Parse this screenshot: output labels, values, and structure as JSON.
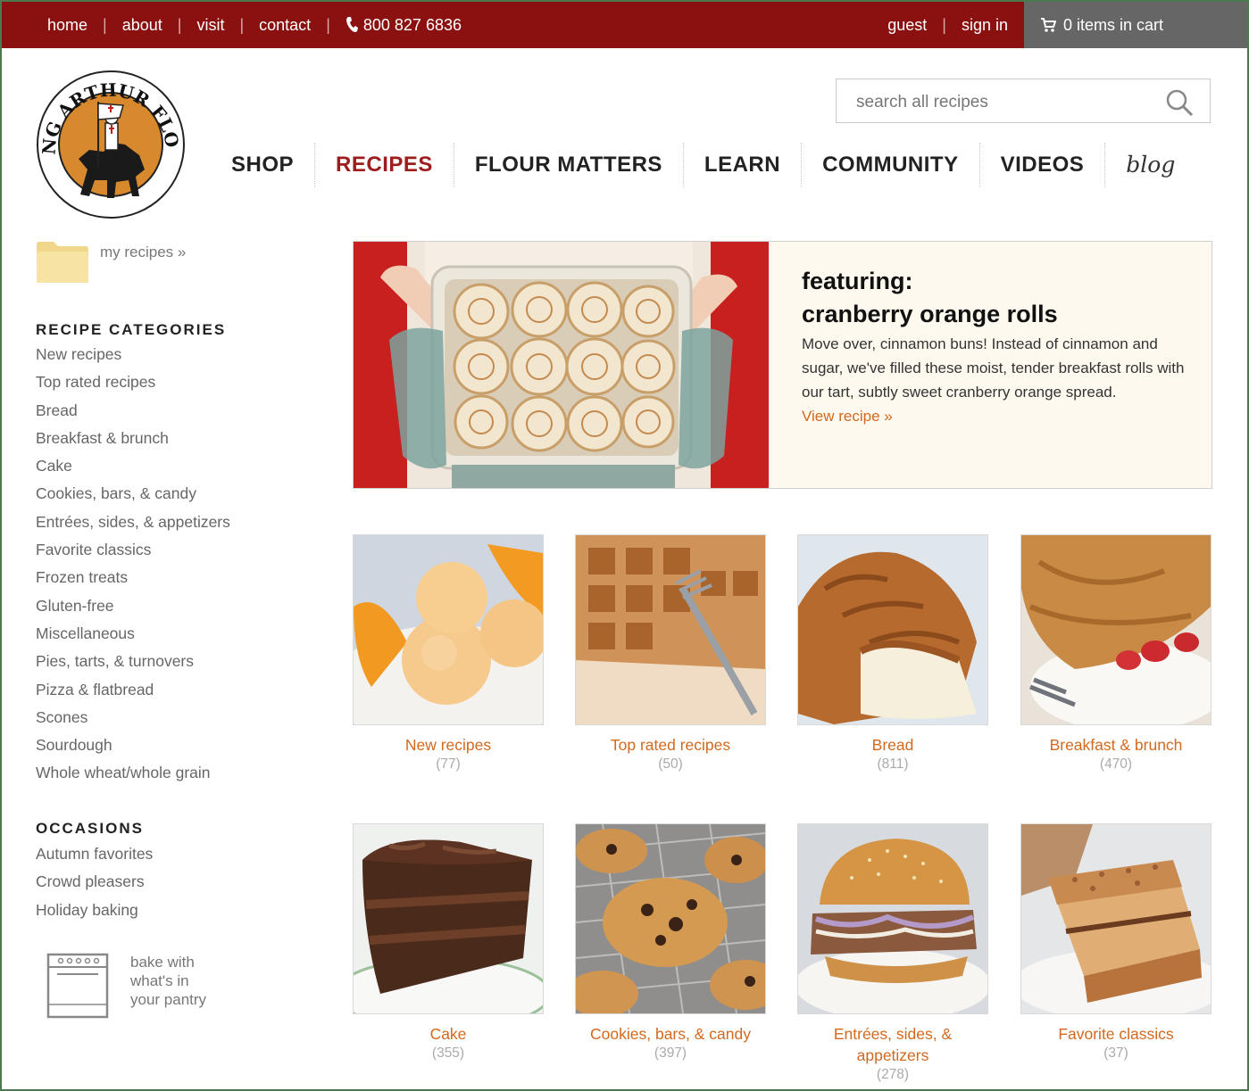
{
  "topbar": {
    "links": [
      "home",
      "about",
      "visit",
      "contact"
    ],
    "phone": "800 827 6836",
    "account": {
      "guest": "guest",
      "sign_in": "sign in"
    },
    "cart": "0 items in cart"
  },
  "logo": {
    "text": "KING ARTHUR FLOUR"
  },
  "search": {
    "placeholder": "search all recipes"
  },
  "main_nav": {
    "shop": "SHOP",
    "recipes": "RECIPES",
    "flour_matters": "FLOUR MATTERS",
    "learn": "LEARN",
    "community": "COMMUNITY",
    "videos": "VIDEOS",
    "blog": "blog"
  },
  "sidebar": {
    "my_recipes": "my recipes »",
    "categories_heading": "RECIPE CATEGORIES",
    "categories": [
      "New recipes",
      "Top rated recipes",
      "Bread",
      "Breakfast & brunch",
      "Cake",
      "Cookies, bars, & candy",
      "Entrées, sides, & appetizers",
      "Favorite classics",
      "Frozen treats",
      "Gluten-free",
      "Miscellaneous",
      "Pies, tarts, & turnovers",
      "Pizza & flatbread",
      "Scones",
      "Sourdough",
      "Whole wheat/whole grain"
    ],
    "occasions_heading": "OCCASIONS",
    "occasions": [
      "Autumn favorites",
      "Crowd pleasers",
      "Holiday baking"
    ],
    "pantry": [
      "bake with",
      "what's in",
      "your pantry"
    ]
  },
  "feature": {
    "kicker": "featuring:",
    "title": "cranberry orange rolls",
    "description": "Move over, cinnamon buns! Instead of cinnamon and sugar, we've filled these moist, tender breakfast rolls with our tart, subtly sweet cranberry orange spread.",
    "link": "View recipe »"
  },
  "tiles": [
    {
      "name": "New recipes",
      "count": "(77)"
    },
    {
      "name": "Top rated recipes",
      "count": "(50)"
    },
    {
      "name": "Bread",
      "count": "(811)"
    },
    {
      "name": "Breakfast & brunch",
      "count": "(470)"
    },
    {
      "name": "Cake",
      "count": "(355)"
    },
    {
      "name": "Cookies, bars, & candy",
      "count": "(397)"
    },
    {
      "name": "Entrées, sides, & appetizers",
      "count": "(278)"
    },
    {
      "name": "Favorite classics",
      "count": "(37)"
    }
  ],
  "colors": {
    "topbar": "#8b1111",
    "cart_bg": "#666666",
    "active_nav": "#9e1c1c",
    "link_orange": "#d2691e",
    "feature_bg": "#fdf9ee"
  }
}
